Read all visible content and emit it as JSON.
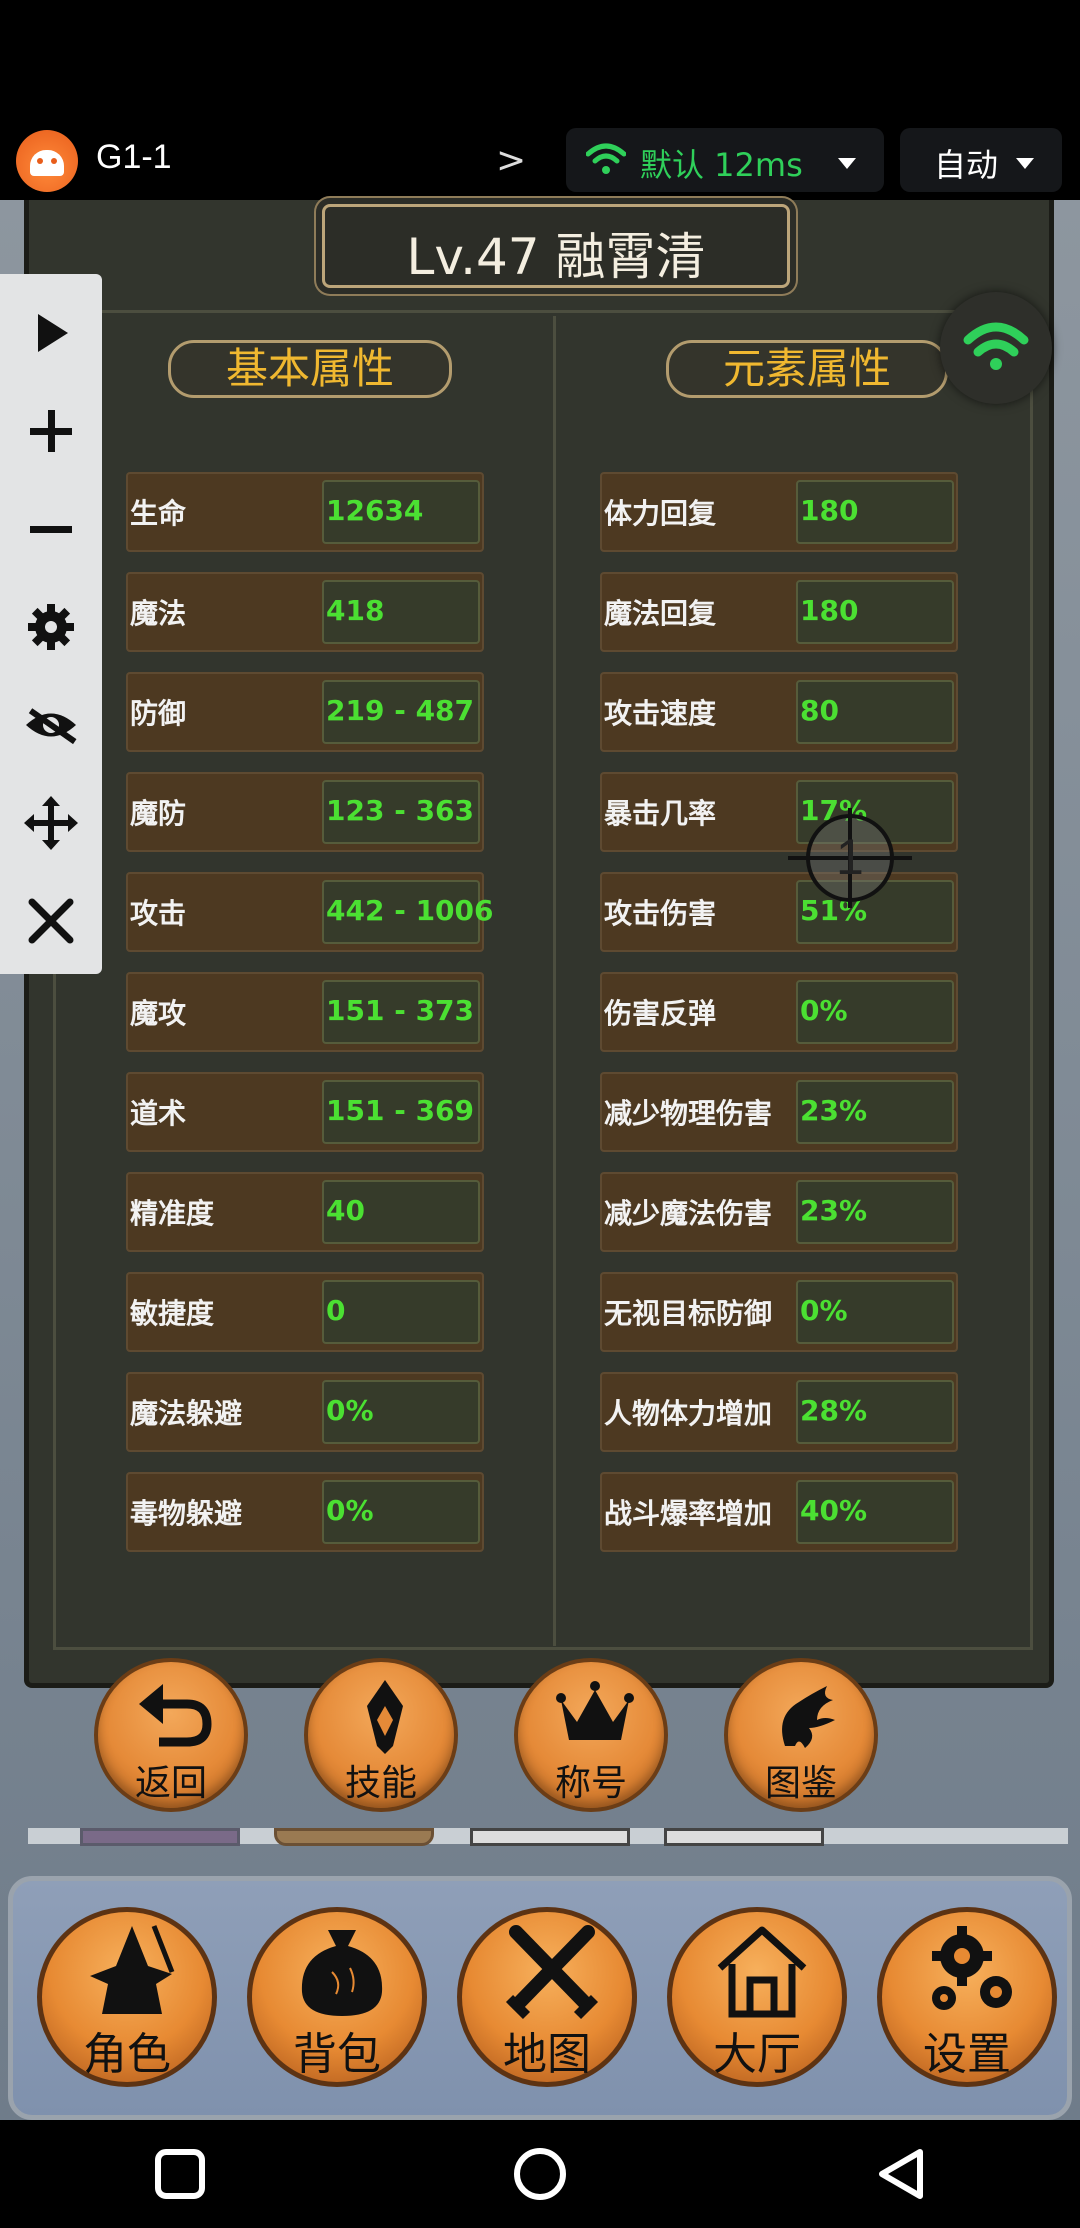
{
  "topbar": {
    "app_name": "G1-1",
    "network_label": "默认 12ms",
    "mode_label": "自动"
  },
  "panel": {
    "title": "Lv.47 融霄清",
    "basic_title": "基本属性",
    "element_title": "元素属性",
    "basic_stats": [
      {
        "label": "生命",
        "value": "12634"
      },
      {
        "label": "魔法",
        "value": "418"
      },
      {
        "label": "防御",
        "value": "219 - 487"
      },
      {
        "label": "魔防",
        "value": "123 - 363"
      },
      {
        "label": "攻击",
        "value": "442 - 1006"
      },
      {
        "label": "魔攻",
        "value": "151 - 373"
      },
      {
        "label": "道术",
        "value": "151 - 369"
      },
      {
        "label": "精准度",
        "value": "40"
      },
      {
        "label": "敏捷度",
        "value": "0"
      },
      {
        "label": "魔法躲避",
        "value": "0%"
      },
      {
        "label": "毒物躲避",
        "value": "0%"
      }
    ],
    "element_stats": [
      {
        "label": "体力回复",
        "value": "180"
      },
      {
        "label": "魔法回复",
        "value": "180"
      },
      {
        "label": "攻击速度",
        "value": "80"
      },
      {
        "label": "暴击几率",
        "value": "17%"
      },
      {
        "label": "攻击伤害",
        "value": "51%"
      },
      {
        "label": "伤害反弹",
        "value": "0%"
      },
      {
        "label": "减少物理伤害",
        "value": "23%"
      },
      {
        "label": "减少魔法伤害",
        "value": "23%"
      },
      {
        "label": "无视目标防御",
        "value": "0%"
      },
      {
        "label": "人物体力增加",
        "value": "28%"
      },
      {
        "label": "战斗爆率增加",
        "value": "40%"
      }
    ]
  },
  "crosshair_label": "1",
  "actions": [
    {
      "label": "返回",
      "icon": "return-icon"
    },
    {
      "label": "技能",
      "icon": "skill-icon"
    },
    {
      "label": "称号",
      "icon": "crown-icon"
    },
    {
      "label": "图鉴",
      "icon": "dragon-icon"
    }
  ],
  "nav": [
    {
      "label": "角色",
      "icon": "wizard-icon"
    },
    {
      "label": "背包",
      "icon": "bag-icon"
    },
    {
      "label": "地图",
      "icon": "swords-icon"
    },
    {
      "label": "大厅",
      "icon": "house-icon"
    },
    {
      "label": "设置",
      "icon": "gears-icon"
    }
  ],
  "colors": {
    "stat_value": "#4be032",
    "section_title": "#f0b830",
    "network": "#2fd05a"
  }
}
